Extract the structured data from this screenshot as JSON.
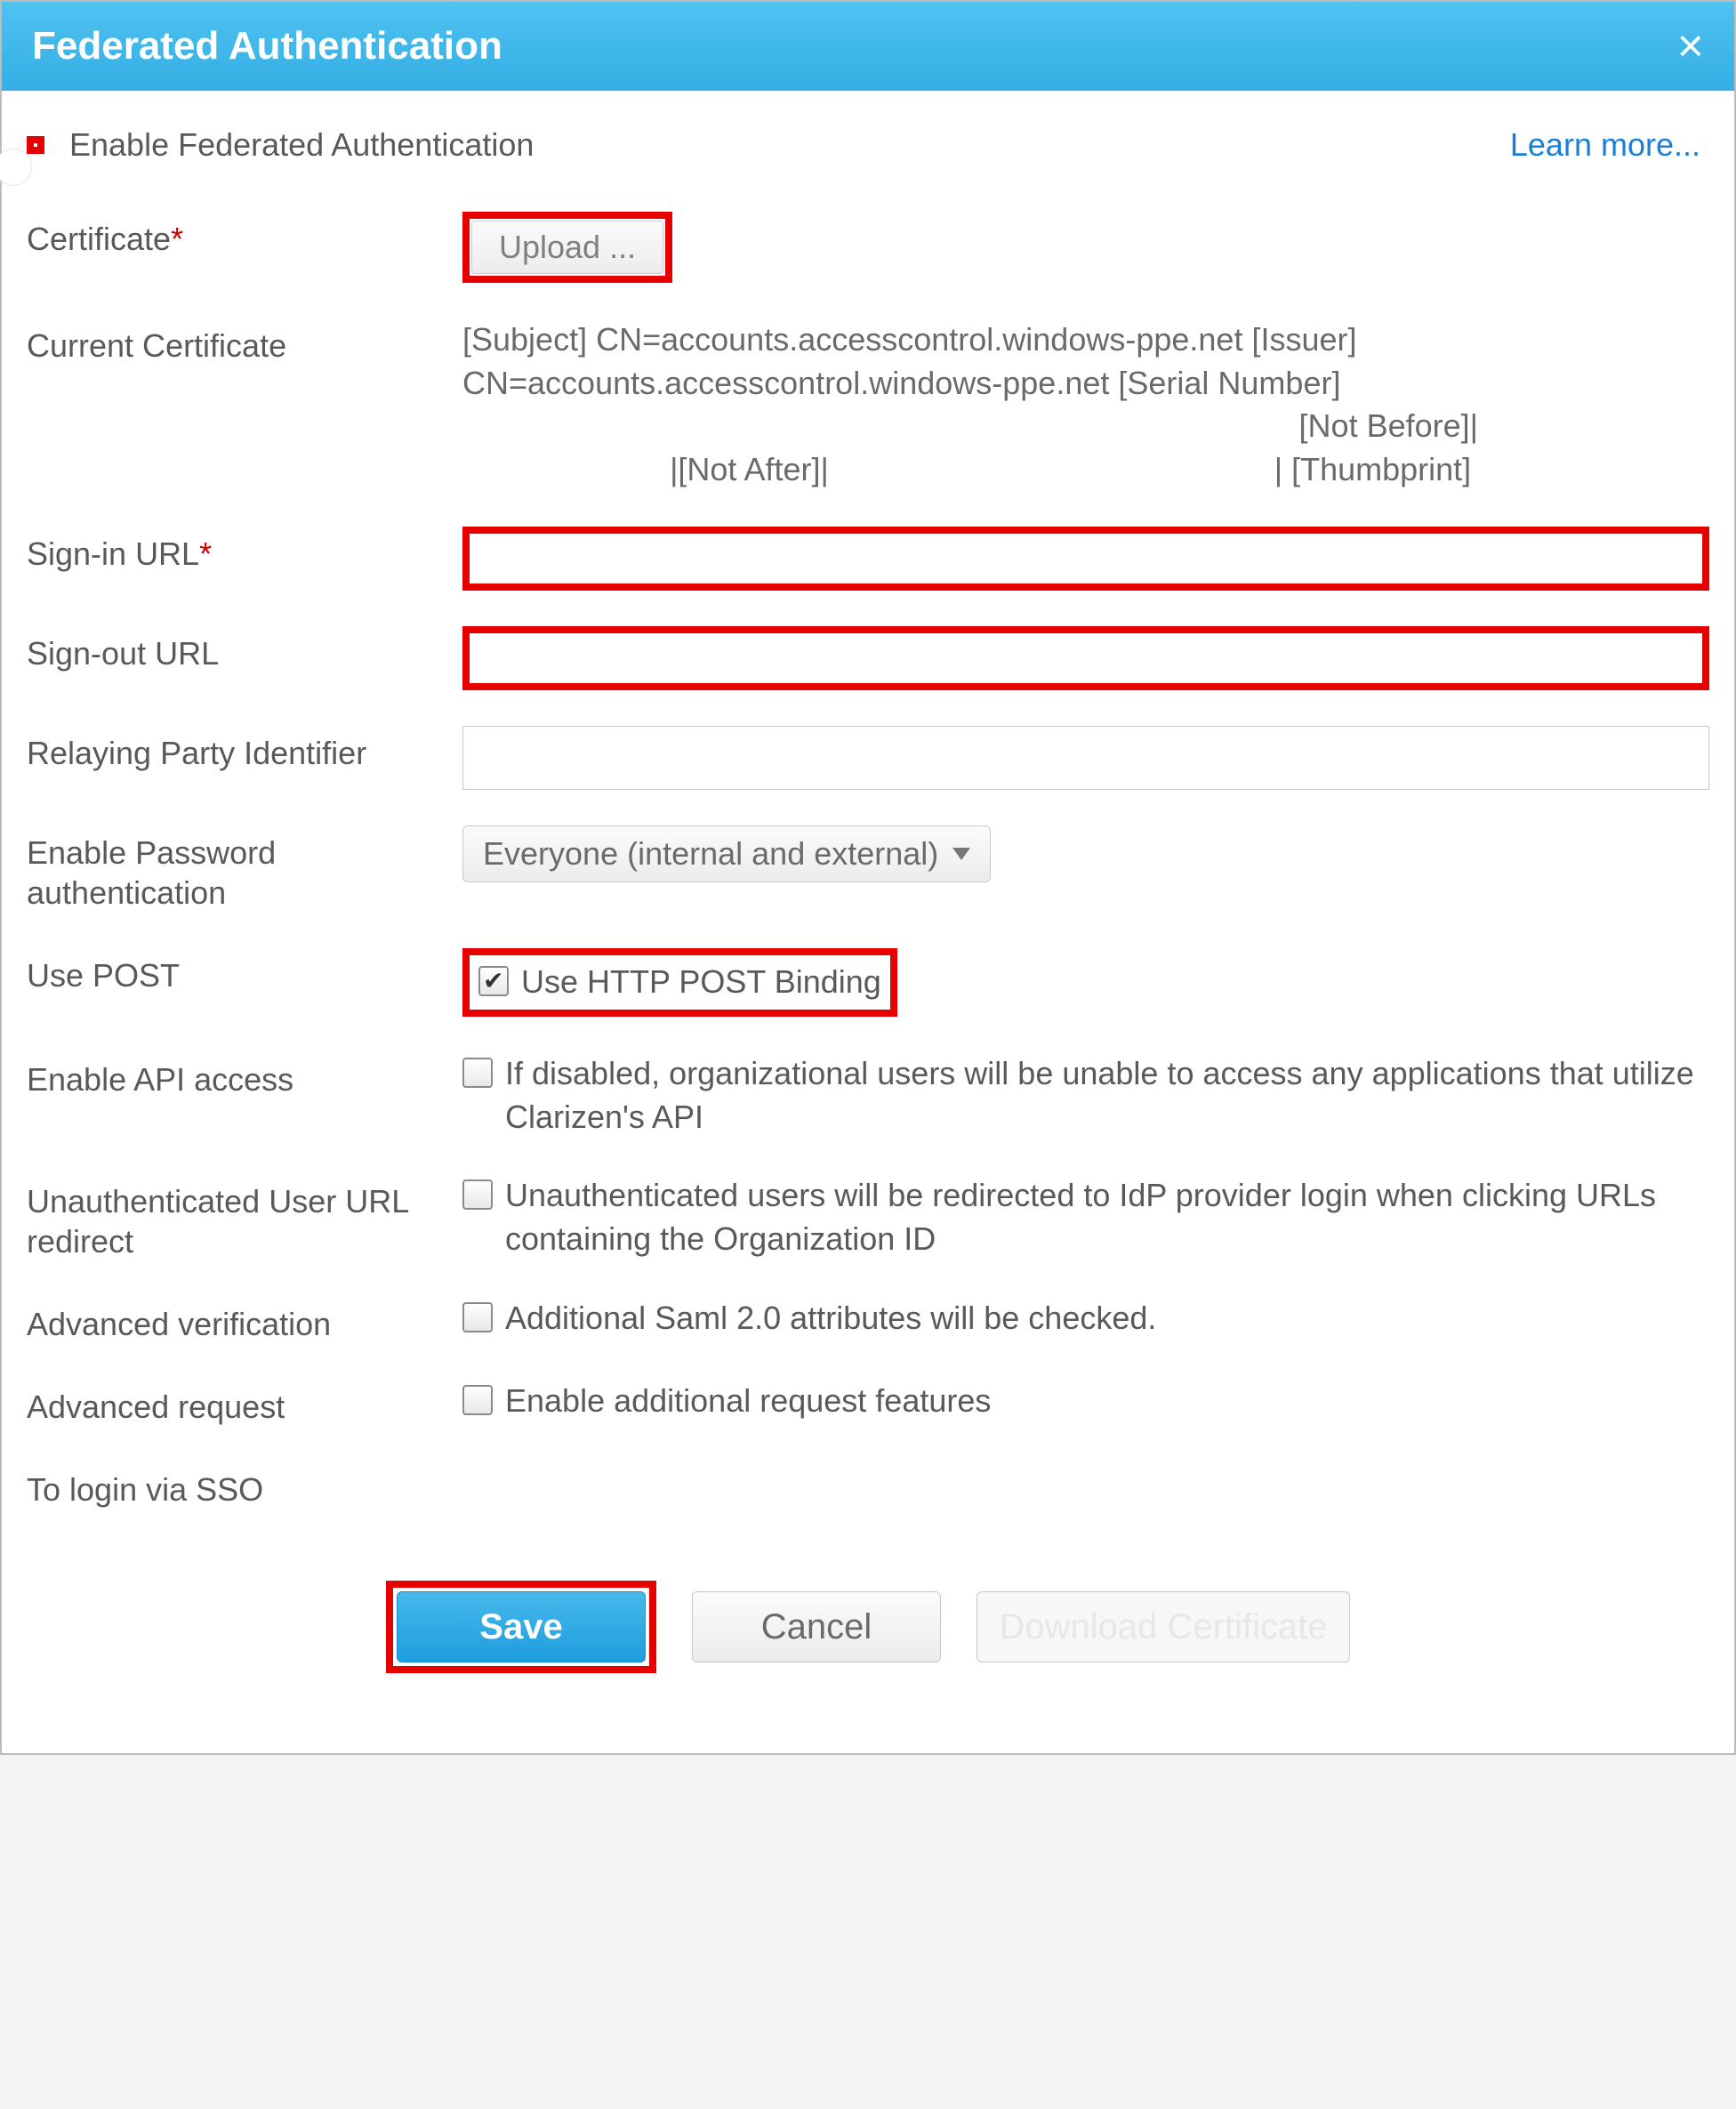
{
  "dialog": {
    "title": "Federated Authentication",
    "learn_more": "Learn more...",
    "enable_label": "Enable Federated Authentication"
  },
  "fields": {
    "certificate_label": "Certificate",
    "upload_label": "Upload ...",
    "current_cert_label": "Current Certificate",
    "current_cert_line1": "[Subject] CN=accounts.accesscontrol.windows-ppe.net [Issuer]",
    "current_cert_line2": "CN=accounts.accesscontrol.windows-ppe.net [Serial Number]",
    "current_cert_line3": "[Not Before]|",
    "current_cert_line4a": "|[Not After]|",
    "current_cert_line4b": "| [Thumbprint]",
    "signin_label": "Sign-in URL",
    "signin_value": "",
    "signout_label": "Sign-out URL",
    "signout_value": "",
    "relaying_label": "Relaying Party Identifier",
    "relaying_value": "",
    "password_auth_label": "Enable Password authentication",
    "password_auth_value": "Everyone (internal and external)",
    "use_post_label": "Use POST",
    "use_post_text": "Use HTTP POST Binding",
    "api_label": "Enable API access",
    "api_text": "If disabled, organizational users will be unable to access any applications that utilize Clarizen's API",
    "unauth_label": "Unauthenticated User URL redirect",
    "unauth_text": "Unauthenticated users will be redirected to IdP provider login when clicking URLs containing the Organization ID",
    "adv_verify_label": "Advanced verification",
    "adv_verify_text": "Additional Saml 2.0 attributes will be checked.",
    "adv_request_label": "Advanced request",
    "adv_request_text": "Enable additional request features",
    "sso_label": "To login via SSO"
  },
  "footer": {
    "save": "Save",
    "cancel": "Cancel",
    "download": "Download Certificate"
  }
}
